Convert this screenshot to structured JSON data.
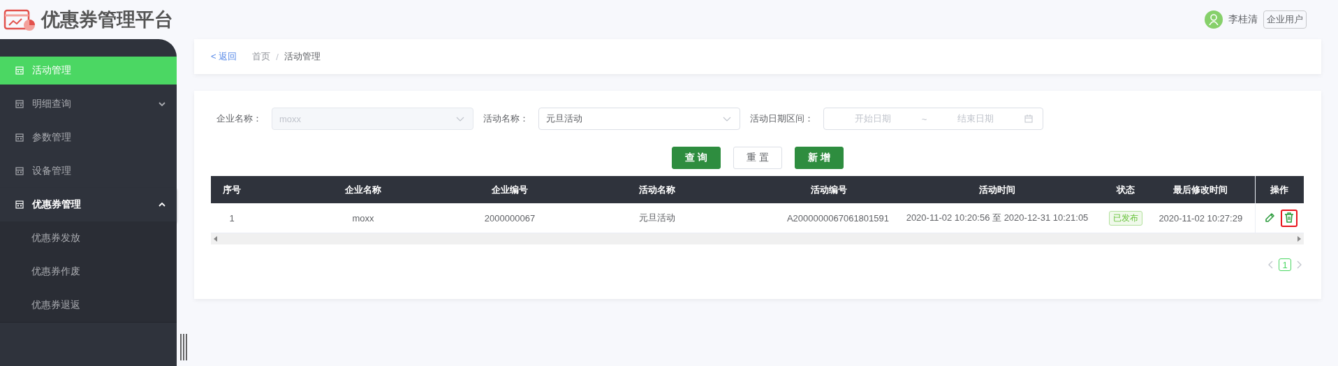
{
  "header": {
    "title": "优惠券管理平台",
    "user_name": "李桂清",
    "user_role": "企业用户"
  },
  "sidebar": {
    "items": [
      {
        "label": "活动管理",
        "selected": true
      },
      {
        "label": "明细查询",
        "selected": false,
        "expanded": false
      },
      {
        "label": "参数管理",
        "selected": false
      },
      {
        "label": "设备管理",
        "selected": false
      },
      {
        "label": "优惠券管理",
        "selected": false,
        "expanded": true,
        "children": [
          {
            "label": "优惠券发放",
            "selected": false
          },
          {
            "label": "优惠券作废",
            "selected": false
          },
          {
            "label": "优惠券退返",
            "selected": false
          }
        ]
      }
    ]
  },
  "breadcrumb": {
    "back": "< 返回",
    "items": [
      "首页",
      "活动管理"
    ],
    "separator": "/"
  },
  "filters": [
    {
      "kind": "select",
      "label": "企业名称：",
      "value": "moxx",
      "disabled": true
    },
    {
      "kind": "select",
      "label": "活动名称：",
      "value": "元旦活动",
      "disabled": false
    },
    {
      "kind": "daterange",
      "label": "活动日期区间：",
      "start_placeholder": "开始日期",
      "separator": "~",
      "end_placeholder": "结束日期"
    }
  ],
  "buttons": [
    {
      "label": "查 询",
      "kind": "primary"
    },
    {
      "label": "重 置",
      "kind": "default"
    },
    {
      "label": "新 增",
      "kind": "primary"
    }
  ],
  "table": {
    "columns": [
      "序号",
      "企业名称",
      "企业编号",
      "活动名称",
      "活动编号",
      "活动时间",
      "状态",
      "最后修改时间",
      "操作"
    ],
    "rows": [
      {
        "cells": [
          "1",
          "moxx",
          "2000000067",
          "元旦活动",
          "A2000000067061801591",
          "2020-11-02 10:20:56 至 2020-12-31 10:21:05"
        ],
        "status": "已发布",
        "modified": "2020-11-02 10:27:29",
        "actions": [
          {
            "kind": "edit",
            "highlighted": false
          },
          {
            "kind": "delete",
            "highlighted": true
          }
        ]
      }
    ]
  },
  "pagination": {
    "pages": [
      {
        "label": "1",
        "selected": true
      }
    ]
  }
}
